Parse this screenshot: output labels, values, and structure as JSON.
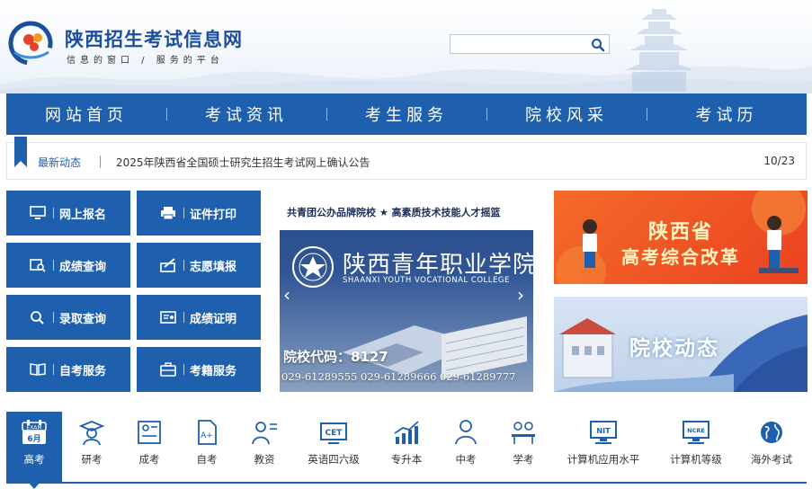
{
  "header": {
    "site_title": "陕西招生考试信息网",
    "slogan": "信息的窗口 / 服务的平台",
    "search_placeholder": ""
  },
  "nav": {
    "items": [
      {
        "label": "网站首页"
      },
      {
        "label": "考试资讯"
      },
      {
        "label": "考生服务"
      },
      {
        "label": "院校风采"
      },
      {
        "label": "考试历"
      }
    ]
  },
  "news": {
    "label": "最新动态",
    "headline": "2025年陕西省全国硕士研究生招生考试网上确认公告",
    "date": "10/23"
  },
  "quick_buttons": [
    {
      "label": "网上报名",
      "icon": "monitor-icon"
    },
    {
      "label": "证件打印",
      "icon": "printer-icon"
    },
    {
      "label": "成绩查询",
      "icon": "score-search-icon"
    },
    {
      "label": "志愿填报",
      "icon": "fill-form-icon"
    },
    {
      "label": "录取查询",
      "icon": "search-icon"
    },
    {
      "label": "成绩证明",
      "icon": "certificate-icon"
    },
    {
      "label": "自考服务",
      "icon": "book-icon"
    },
    {
      "label": "考籍服务",
      "icon": "briefcase-icon"
    }
  ],
  "banner": {
    "tagline": "共青团公办品牌院校 ★ 高素质技术技能人才摇篮",
    "school_name": "陕西青年职业学院",
    "school_name_en": "SHAANXI YOUTH VOCATIONAL COLLEGE",
    "code": "院校代码：8127",
    "phones": "029-61289555   029-61289666   029-61289777"
  },
  "promos": {
    "gaokao_reform_line1": "陕西省",
    "gaokao_reform_line2": "高考综合改革",
    "school_news": "院校动态"
  },
  "tabs": [
    {
      "label": "高考",
      "icon": "exam-calendar-icon",
      "badge_top": "EXAM",
      "badge_bottom": "6月"
    },
    {
      "label": "研考",
      "icon": "graduate-icon"
    },
    {
      "label": "成考",
      "icon": "adult-exam-icon"
    },
    {
      "label": "自考",
      "icon": "self-exam-icon"
    },
    {
      "label": "教资",
      "icon": "teacher-icon"
    },
    {
      "label": "英语四六级",
      "icon": "cet-icon",
      "badge": "CET"
    },
    {
      "label": "专升本",
      "icon": "upgrade-chart-icon"
    },
    {
      "label": "中考",
      "icon": "student-icon"
    },
    {
      "label": "学考",
      "icon": "classroom-icon"
    },
    {
      "label": "计算机应用水平",
      "icon": "nit-icon",
      "badge": "NIT"
    },
    {
      "label": "计算机等级",
      "icon": "ncre-icon",
      "badge": "NCRE"
    },
    {
      "label": "海外考试",
      "icon": "globe-icon"
    }
  ],
  "colors": {
    "primary": "#1e5fae",
    "orange": "#ea4220"
  }
}
